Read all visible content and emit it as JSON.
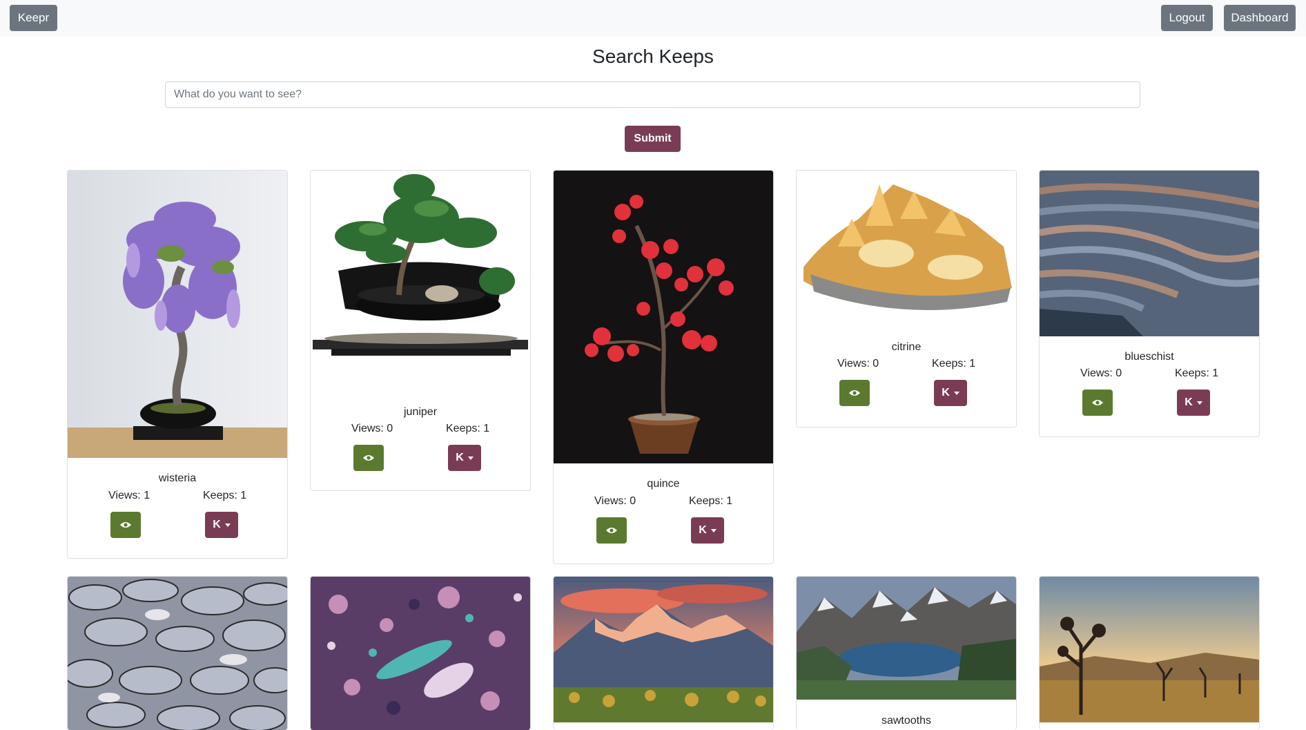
{
  "nav": {
    "brand": "Keepr",
    "logout": "Logout",
    "dashboard": "Dashboard"
  },
  "page": {
    "title": "Search Keeps"
  },
  "search": {
    "placeholder": "What do you want to see?",
    "submit": "Submit"
  },
  "keep_button_label": "K",
  "stat_labels": {
    "views": "Views:",
    "keeps": "Keeps:"
  },
  "keeps": [
    {
      "name": "wisteria",
      "views": "Views: 1",
      "keeps": "Keeps: 1"
    },
    {
      "name": "juniper",
      "views": "Views: 0",
      "keeps": "Keeps: 1"
    },
    {
      "name": "quince",
      "views": "Views: 0",
      "keeps": "Keeps: 1"
    },
    {
      "name": "citrine",
      "views": "Views: 0",
      "keeps": "Keeps: 1"
    },
    {
      "name": "blueschist",
      "views": "Views: 0",
      "keeps": "Keeps: 1"
    },
    {
      "name": "",
      "views": "",
      "keeps": ""
    },
    {
      "name": "",
      "views": "",
      "keeps": ""
    },
    {
      "name": "",
      "views": "",
      "keeps": ""
    },
    {
      "name": "sawtooths",
      "views": "",
      "keeps": ""
    },
    {
      "name": "",
      "views": "",
      "keeps": ""
    }
  ],
  "colors": {
    "view_button": "#5b7a30",
    "keep_button": "#7a3c55",
    "nav_button": "#6c757d"
  },
  "icons": {
    "view": "eye-icon",
    "keep_menu": "caret-down-icon"
  }
}
